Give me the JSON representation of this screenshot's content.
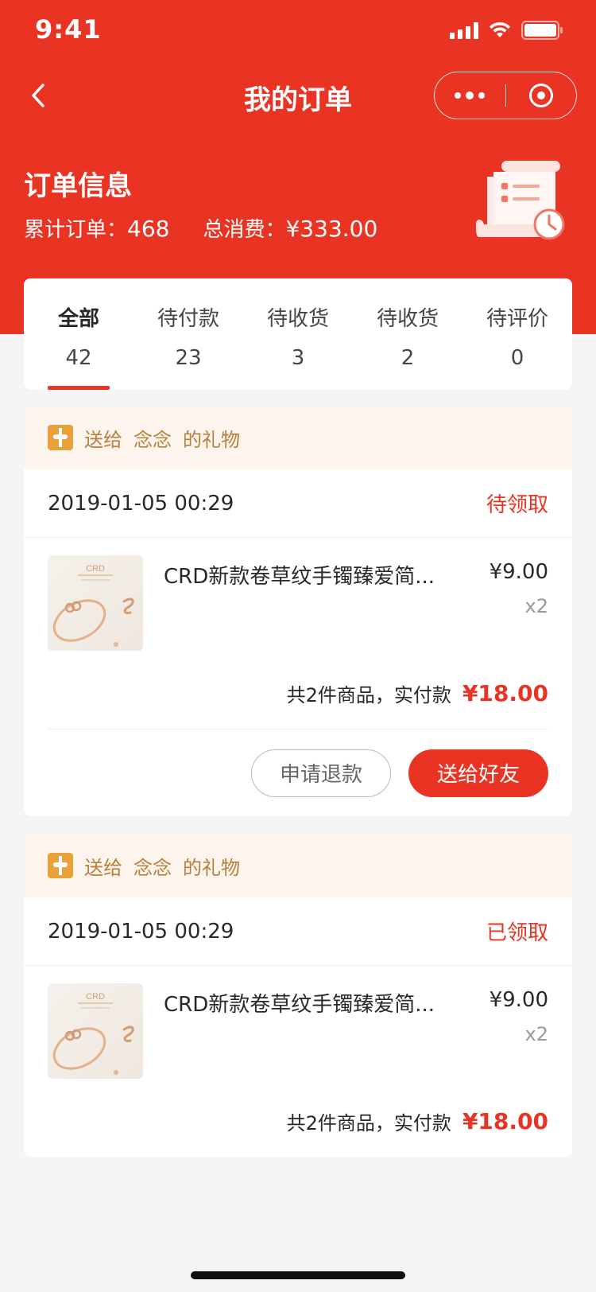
{
  "status_bar": {
    "time": "9:41"
  },
  "nav": {
    "title": "我的订单"
  },
  "order_info": {
    "title": "订单信息",
    "total_orders_label": "累计订单：",
    "total_orders_value": "468",
    "total_spend_label": "总消费：",
    "total_spend_value": "¥333.00"
  },
  "tabs": [
    {
      "label": "全部",
      "count": "42",
      "active": true
    },
    {
      "label": "待付款",
      "count": "23"
    },
    {
      "label": "待收货",
      "count": "3"
    },
    {
      "label": "待收货",
      "count": "2"
    },
    {
      "label": "待评价",
      "count": "0"
    }
  ],
  "orders": [
    {
      "gift": {
        "prefix": "送给",
        "recipient": "念念",
        "suffix": "的礼物"
      },
      "date": "2019-01-05 00:29",
      "status": "待领取",
      "item": {
        "name": "CRD新款卷草纹手镯臻爱简...",
        "price": "¥9.00",
        "qty": "x2"
      },
      "summary_text": "共2件商品，实付款",
      "summary_amount": "¥18.00",
      "actions": {
        "refund": "申请退款",
        "send": "送给好友"
      }
    },
    {
      "gift": {
        "prefix": "送给",
        "recipient": "念念",
        "suffix": "的礼物"
      },
      "date": "2019-01-05 00:29",
      "status": "已领取",
      "item": {
        "name": "CRD新款卷草纹手镯臻爱简...",
        "price": "¥9.00",
        "qty": "x2"
      },
      "summary_text": "共2件商品，实付款",
      "summary_amount": "¥18.00"
    }
  ],
  "product_image": {
    "brand": "CRD"
  },
  "colors": {
    "primary": "#e93323",
    "gift_bg": "#fdf5ed",
    "gift_text": "#b77f3c"
  },
  "icons": [
    "back-arrow-icon",
    "more-dots-icon",
    "close-target-icon",
    "gift-icon",
    "receipt-icon"
  ]
}
